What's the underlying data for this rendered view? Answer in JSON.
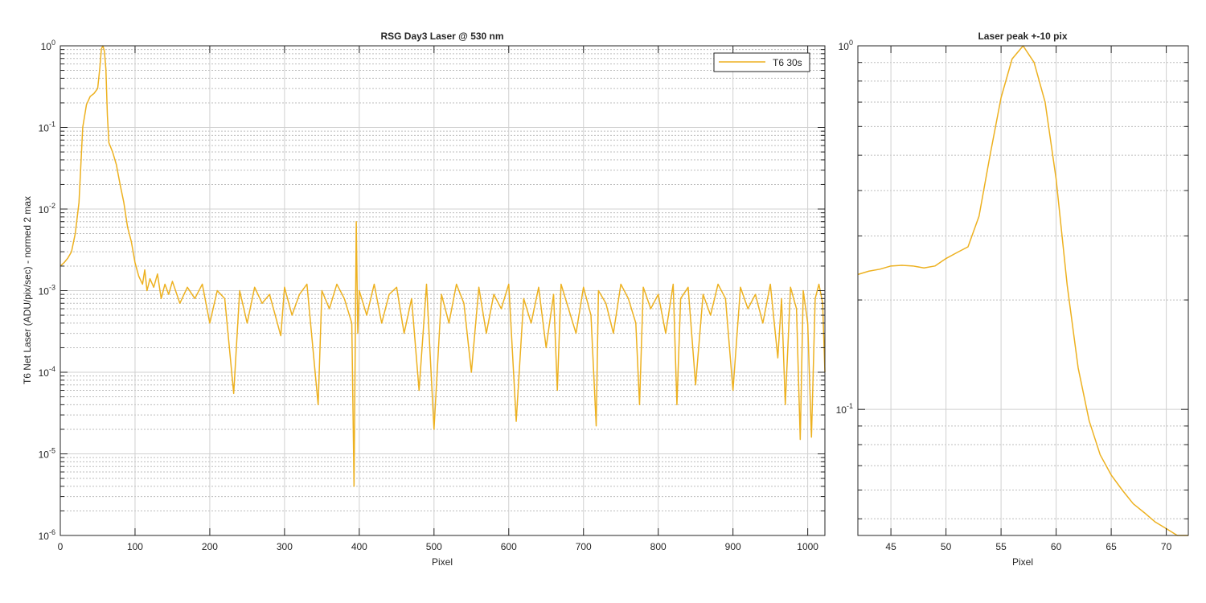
{
  "chart_data": [
    {
      "type": "line",
      "title": "RSG  Day3 Laser @ 530 nm",
      "xlabel": "Pixel",
      "ylabel": "T6 Net Laser (ADU/pix/sec) - normed 2 max",
      "xlim": [
        0,
        1023
      ],
      "ylim": [
        1e-06,
        1
      ],
      "yscale": "log",
      "grid": true,
      "minor_grid": true,
      "legend_position": "top-right",
      "x_ticks": [
        0,
        100,
        200,
        300,
        400,
        500,
        600,
        700,
        800,
        900,
        1000
      ],
      "x_tick_labels": [
        "0",
        "100",
        "200",
        "300",
        "400",
        "500",
        "600",
        "700",
        "800",
        "900",
        "1000"
      ],
      "y_ticks": [
        1e-06,
        1e-05,
        0.0001,
        0.001,
        0.01,
        0.1,
        1
      ],
      "y_tick_labels": [
        {
          "base": "10",
          "exp": "-6"
        },
        {
          "base": "10",
          "exp": "-5"
        },
        {
          "base": "10",
          "exp": "-4"
        },
        {
          "base": "10",
          "exp": "-3"
        },
        {
          "base": "10",
          "exp": "-2"
        },
        {
          "base": "10",
          "exp": "-1"
        },
        {
          "base": "10",
          "exp": "0"
        }
      ],
      "series": [
        {
          "name": "T6 30s",
          "color": "#EDB120",
          "x": [
            0,
            5,
            10,
            15,
            20,
            25,
            30,
            35,
            40,
            45,
            50,
            53,
            55,
            57,
            59,
            61,
            63,
            65,
            70,
            75,
            80,
            85,
            90,
            95,
            100,
            105,
            110,
            113,
            116,
            120,
            125,
            130,
            135,
            140,
            145,
            150,
            160,
            170,
            180,
            190,
            200,
            210,
            220,
            232,
            240,
            250,
            260,
            270,
            280,
            295,
            300,
            310,
            320,
            330,
            345,
            350,
            360,
            370,
            380,
            390,
            393,
            396,
            398,
            400,
            410,
            420,
            430,
            440,
            450,
            460,
            470,
            480,
            490,
            500,
            510,
            520,
            530,
            540,
            550,
            560,
            570,
            580,
            590,
            600,
            610,
            620,
            630,
            640,
            650,
            660,
            665,
            670,
            680,
            690,
            700,
            710,
            717,
            720,
            730,
            740,
            750,
            760,
            770,
            775,
            780,
            790,
            800,
            810,
            820,
            825,
            830,
            840,
            850,
            860,
            870,
            880,
            890,
            900,
            910,
            920,
            930,
            940,
            950,
            960,
            965,
            970,
            977,
            985,
            990,
            994,
            1000,
            1005,
            1010,
            1015,
            1020,
            1023
          ],
          "y": [
            0.002,
            0.0022,
            0.0025,
            0.003,
            0.005,
            0.012,
            0.1,
            0.19,
            0.24,
            0.26,
            0.3,
            0.55,
            0.92,
            1.0,
            0.86,
            0.52,
            0.14,
            0.065,
            0.05,
            0.035,
            0.02,
            0.012,
            0.006,
            0.004,
            0.0022,
            0.0015,
            0.0012,
            0.0018,
            0.001,
            0.0014,
            0.0011,
            0.0016,
            0.0008,
            0.0012,
            0.0009,
            0.0013,
            0.0007,
            0.0011,
            0.0008,
            0.0012,
            0.0004,
            0.001,
            0.0008,
            5.5e-05,
            0.001,
            0.0004,
            0.0011,
            0.0007,
            0.0009,
            0.00028,
            0.0011,
            0.0005,
            0.0009,
            0.0012,
            4e-05,
            0.001,
            0.0006,
            0.0012,
            0.0008,
            0.0004,
            4e-06,
            0.007,
            0.0003,
            0.001,
            0.0005,
            0.0012,
            0.0004,
            0.0009,
            0.0011,
            0.0003,
            0.0008,
            6e-05,
            0.0012,
            2e-05,
            0.0009,
            0.0004,
            0.0012,
            0.0007,
            0.0001,
            0.0011,
            0.0003,
            0.0009,
            0.0006,
            0.0012,
            2.5e-05,
            0.0008,
            0.0004,
            0.0011,
            0.0002,
            0.0009,
            6e-05,
            0.0012,
            0.0006,
            0.0003,
            0.0011,
            0.0005,
            2.2e-05,
            0.001,
            0.0007,
            0.0003,
            0.0012,
            0.0008,
            0.0004,
            4e-05,
            0.0011,
            0.0006,
            0.0009,
            0.0003,
            0.0012,
            4e-05,
            0.0008,
            0.0011,
            7e-05,
            0.0009,
            0.0005,
            0.0012,
            0.0008,
            6e-05,
            0.0011,
            0.0006,
            0.0009,
            0.0004,
            0.0012,
            0.00015,
            0.0008,
            4e-05,
            0.0011,
            0.0006,
            1.5e-05,
            0.001,
            0.0004,
            1.6e-05,
            0.0008,
            0.0012,
            0.0007,
            0.0001
          ]
        }
      ]
    },
    {
      "type": "line",
      "title": "Laser peak +-10 pix",
      "xlabel": "Pixel",
      "ylabel": "",
      "xlim": [
        42,
        72
      ],
      "ylim": [
        0.045,
        1
      ],
      "yscale": "log",
      "grid": true,
      "minor_grid": true,
      "x_ticks": [
        45,
        50,
        55,
        60,
        65,
        70
      ],
      "x_tick_labels": [
        "45",
        "50",
        "55",
        "60",
        "65",
        "70"
      ],
      "y_ticks": [
        0.1,
        1
      ],
      "y_tick_labels": [
        {
          "base": "10",
          "exp": "-1"
        },
        {
          "base": "10",
          "exp": "0"
        }
      ],
      "series": [
        {
          "name": "",
          "color": "#EDB120",
          "x": [
            42,
            43,
            44,
            45,
            46,
            47,
            48,
            49,
            50,
            51,
            52,
            53,
            54,
            55,
            56,
            57,
            58,
            59,
            60,
            61,
            62,
            63,
            64,
            65,
            66,
            67,
            68,
            69,
            70,
            71,
            72
          ],
          "y": [
            0.235,
            0.24,
            0.243,
            0.248,
            0.249,
            0.248,
            0.245,
            0.248,
            0.26,
            0.27,
            0.28,
            0.34,
            0.5,
            0.72,
            0.92,
            1.0,
            0.9,
            0.7,
            0.43,
            0.22,
            0.13,
            0.093,
            0.075,
            0.066,
            0.06,
            0.055,
            0.052,
            0.049,
            0.047,
            0.045,
            0.044
          ]
        }
      ]
    }
  ]
}
